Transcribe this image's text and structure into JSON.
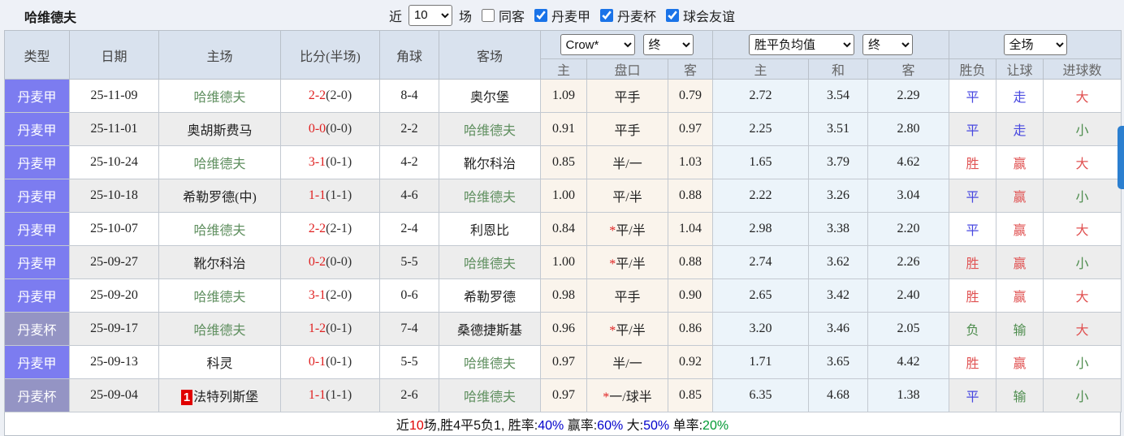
{
  "topbar": {
    "title": "哈维德夫",
    "recent_label": "近",
    "recent_select_value": "10",
    "recent_suffix_label": "场",
    "filters": [
      {
        "label": "同客",
        "checked": false
      },
      {
        "label": "丹麦甲",
        "checked": true
      },
      {
        "label": "丹麦杯",
        "checked": true
      },
      {
        "label": "球会友谊",
        "checked": true
      }
    ]
  },
  "table": {
    "main_headers": [
      "类型",
      "日期",
      "主场",
      "比分(半场)",
      "角球",
      "客场"
    ],
    "selects": {
      "ah_company": "Crow*",
      "ah_time": "终",
      "eu_company": "胜平负均值",
      "eu_time": "终",
      "scope": "全场"
    },
    "sub_headers": [
      "主",
      "盘口",
      "客",
      "主",
      "和",
      "客",
      "胜负",
      "让球",
      "进球数"
    ],
    "rows": [
      {
        "type": "丹麦甲",
        "date": "25-11-09",
        "home": "哈维德夫",
        "home_subject": true,
        "home_badge": "",
        "score": "2-2",
        "half": "(2-0)",
        "corners": "8-4",
        "away": "奥尔堡",
        "away_subject": false,
        "ah_home": "1.09",
        "handicap": "平手",
        "ah_away": "0.79",
        "eu_home": "2.72",
        "eu_draw": "3.54",
        "eu_away": "2.29",
        "res_wdl": "平",
        "res_ah": "走",
        "res_goal": "大"
      },
      {
        "type": "丹麦甲",
        "date": "25-11-01",
        "home": "奥胡斯费马",
        "home_subject": false,
        "home_badge": "",
        "score": "0-0",
        "half": "(0-0)",
        "corners": "2-2",
        "away": "哈维德夫",
        "away_subject": true,
        "ah_home": "0.91",
        "handicap": "平手",
        "ah_away": "0.97",
        "eu_home": "2.25",
        "eu_draw": "3.51",
        "eu_away": "2.80",
        "res_wdl": "平",
        "res_ah": "走",
        "res_goal": "小"
      },
      {
        "type": "丹麦甲",
        "date": "25-10-24",
        "home": "哈维德夫",
        "home_subject": true,
        "home_badge": "",
        "score": "3-1",
        "half": "(0-1)",
        "corners": "4-2",
        "away": "靴尔科治",
        "away_subject": false,
        "ah_home": "0.85",
        "handicap": "半/一",
        "ah_away": "1.03",
        "eu_home": "1.65",
        "eu_draw": "3.79",
        "eu_away": "4.62",
        "res_wdl": "胜",
        "res_ah": "赢",
        "res_goal": "大"
      },
      {
        "type": "丹麦甲",
        "date": "25-10-18",
        "home": "希勒罗德(中)",
        "home_subject": false,
        "home_badge": "",
        "score": "1-1",
        "half": "(1-1)",
        "corners": "4-6",
        "away": "哈维德夫",
        "away_subject": true,
        "ah_home": "1.00",
        "handicap": "平/半",
        "ah_away": "0.88",
        "eu_home": "2.22",
        "eu_draw": "3.26",
        "eu_away": "3.04",
        "res_wdl": "平",
        "res_ah": "赢",
        "res_goal": "小"
      },
      {
        "type": "丹麦甲",
        "date": "25-10-07",
        "home": "哈维德夫",
        "home_subject": true,
        "home_badge": "",
        "score": "2-2",
        "half": "(2-1)",
        "corners": "2-4",
        "away": "利恩比",
        "away_subject": false,
        "ah_home": "0.84",
        "handicap": "*平/半",
        "ah_away": "1.04",
        "eu_home": "2.98",
        "eu_draw": "3.38",
        "eu_away": "2.20",
        "res_wdl": "平",
        "res_ah": "赢",
        "res_goal": "大"
      },
      {
        "type": "丹麦甲",
        "date": "25-09-27",
        "home": "靴尔科治",
        "home_subject": false,
        "home_badge": "",
        "score": "0-2",
        "half": "(0-0)",
        "corners": "5-5",
        "away": "哈维德夫",
        "away_subject": true,
        "ah_home": "1.00",
        "handicap": "*平/半",
        "ah_away": "0.88",
        "eu_home": "2.74",
        "eu_draw": "3.62",
        "eu_away": "2.26",
        "res_wdl": "胜",
        "res_ah": "赢",
        "res_goal": "小"
      },
      {
        "type": "丹麦甲",
        "date": "25-09-20",
        "home": "哈维德夫",
        "home_subject": true,
        "home_badge": "",
        "score": "3-1",
        "half": "(2-0)",
        "corners": "0-6",
        "away": "希勒罗德",
        "away_subject": false,
        "ah_home": "0.98",
        "handicap": "平手",
        "ah_away": "0.90",
        "eu_home": "2.65",
        "eu_draw": "3.42",
        "eu_away": "2.40",
        "res_wdl": "胜",
        "res_ah": "赢",
        "res_goal": "大"
      },
      {
        "type": "丹麦杯",
        "date": "25-09-17",
        "home": "哈维德夫",
        "home_subject": true,
        "home_badge": "",
        "score": "1-2",
        "half": "(0-1)",
        "corners": "7-4",
        "away": "桑德捷斯基",
        "away_subject": false,
        "ah_home": "0.96",
        "handicap": "*平/半",
        "ah_away": "0.86",
        "eu_home": "3.20",
        "eu_draw": "3.46",
        "eu_away": "2.05",
        "res_wdl": "负",
        "res_ah": "输",
        "res_goal": "大"
      },
      {
        "type": "丹麦甲",
        "date": "25-09-13",
        "home": "科灵",
        "home_subject": false,
        "home_badge": "",
        "score": "0-1",
        "half": "(0-1)",
        "corners": "5-5",
        "away": "哈维德夫",
        "away_subject": true,
        "ah_home": "0.97",
        "handicap": "半/一",
        "ah_away": "0.92",
        "eu_home": "1.71",
        "eu_draw": "3.65",
        "eu_away": "4.42",
        "res_wdl": "胜",
        "res_ah": "赢",
        "res_goal": "小"
      },
      {
        "type": "丹麦杯",
        "date": "25-09-04",
        "home": "法特列斯堡",
        "home_subject": false,
        "home_badge": "1",
        "score": "1-1",
        "half": "(1-1)",
        "corners": "2-6",
        "away": "哈维德夫",
        "away_subject": true,
        "ah_home": "0.97",
        "handicap": "*一/球半",
        "ah_away": "0.85",
        "eu_home": "6.35",
        "eu_draw": "4.68",
        "eu_away": "1.38",
        "res_wdl": "平",
        "res_ah": "输",
        "res_goal": "小"
      }
    ]
  },
  "footer": {
    "segments": [
      {
        "text": "近"
      },
      {
        "text": "10",
        "color": "red"
      },
      {
        "text": "场,胜4平5负1, "
      },
      {
        "text": "胜率:"
      },
      {
        "text": "40%",
        "color": "blue"
      },
      {
        "text": " 赢率:"
      },
      {
        "text": "60%",
        "color": "blue"
      },
      {
        "text": " 大:"
      },
      {
        "text": "50%",
        "color": "blue"
      },
      {
        "text": " 单率:"
      },
      {
        "text": "20%",
        "color": "green"
      }
    ]
  },
  "colors": {
    "type_bg": {
      "丹麦甲": "#7c7cf0",
      "丹麦杯": "#9494c4"
    },
    "result_class": {
      "平": "blue",
      "胜": "red",
      "负": "green",
      "走": "blue",
      "赢": "red",
      "输": "green",
      "大": "red",
      "小": "green"
    },
    "subject_team": "#5f8f5f",
    "score_red": "#e02222",
    "scroll_thumb": "#2b7fd0"
  }
}
